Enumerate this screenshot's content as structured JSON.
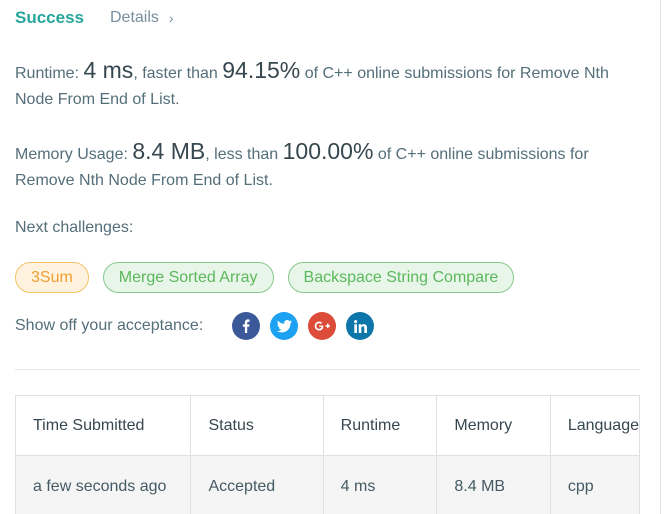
{
  "header": {
    "status": "Success",
    "details_label": "Details",
    "details_chevron": "›"
  },
  "runtime": {
    "label": "Runtime: ",
    "value": "4 ms",
    "faster_text": ", faster than ",
    "percent": "94.15%",
    "tail": " of C++ online submissions for Remove Nth Node From End of List."
  },
  "memory": {
    "label": "Memory Usage: ",
    "value": "8.4 MB",
    "less_text": ", less than ",
    "percent": "100.00%",
    "tail": " of C++ online submissions for Remove Nth Node From End of List."
  },
  "next_challenges": {
    "label": "Next challenges:",
    "items": [
      {
        "label": "3Sum",
        "difficulty": "easy-color"
      },
      {
        "label": "Merge Sorted Array",
        "difficulty": "green"
      },
      {
        "label": "Backspace String Compare",
        "difficulty": "green"
      }
    ]
  },
  "share": {
    "label": "Show off your acceptance:",
    "icons": [
      "facebook-icon",
      "twitter-icon",
      "google-plus-icon",
      "linkedin-icon"
    ]
  },
  "table": {
    "headers": [
      "Time Submitted",
      "Status",
      "Runtime",
      "Memory",
      "Language"
    ],
    "rows": [
      [
        "a few seconds ago",
        "Accepted",
        "4 ms",
        "8.4 MB",
        "cpp"
      ]
    ]
  },
  "colors": {
    "success": "#26a69a",
    "accepted": "#26a69a",
    "chip_easy_border": "#f3c267",
    "chip_green_border": "#86c98a"
  }
}
